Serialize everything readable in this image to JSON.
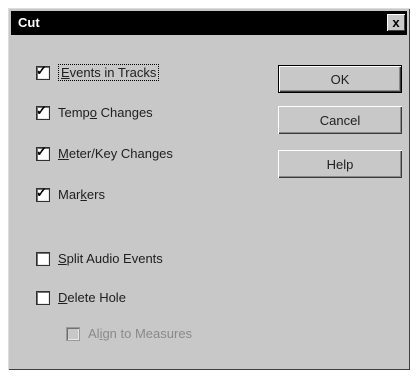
{
  "window": {
    "title": "Cut",
    "close_label": "x"
  },
  "options": [
    {
      "pre": "",
      "u": "E",
      "post": "vents in Tracks",
      "checked": true,
      "enabled": true
    },
    {
      "pre": "Temp",
      "u": "o",
      "post": " Changes",
      "checked": true,
      "enabled": true
    },
    {
      "pre": "",
      "u": "M",
      "post": "eter/Key Changes",
      "checked": true,
      "enabled": true
    },
    {
      "pre": "Mar",
      "u": "k",
      "post": "ers",
      "checked": true,
      "enabled": true
    },
    {
      "pre": "",
      "u": "S",
      "post": "plit Audio Events",
      "checked": false,
      "enabled": true
    },
    {
      "pre": "",
      "u": "D",
      "post": "elete Hole",
      "checked": false,
      "enabled": true
    },
    {
      "pre": "Al",
      "u": "i",
      "post": "gn to Measures",
      "checked": false,
      "enabled": false
    }
  ],
  "buttons": {
    "ok": "OK",
    "cancel": "Cancel",
    "help": "Help"
  }
}
